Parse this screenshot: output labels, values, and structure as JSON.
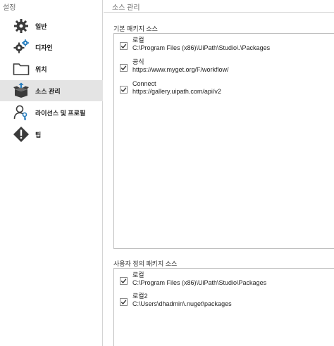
{
  "sidebar": {
    "title": "설정",
    "items": [
      {
        "label": "일반",
        "icon": "gear-icon"
      },
      {
        "label": "디자인",
        "icon": "gears-icon"
      },
      {
        "label": "위치",
        "icon": "folder-icon"
      },
      {
        "label": "소스 관리",
        "icon": "package-icon"
      },
      {
        "label": "라이선스 및 프로필",
        "icon": "user-key-icon"
      },
      {
        "label": "팁",
        "icon": "tip-icon"
      }
    ],
    "selected_index": 3,
    "selected_bg": "#e4e4e4"
  },
  "main": {
    "title": "소스 관리",
    "default_sources": {
      "label": "기본 패키지 소스",
      "items": [
        {
          "name": "로컬",
          "path": "C:\\Program Files (x86)\\UiPath\\Studio\\.\\Packages",
          "checked": true
        },
        {
          "name": "공식",
          "path": "https://www.myget.org/F/workflow/",
          "checked": true
        },
        {
          "name": "Connect",
          "path": "https://gallery.uipath.com/api/v2",
          "checked": true
        }
      ]
    },
    "custom_sources": {
      "label": "사용자 정의 패키지 소스",
      "items": [
        {
          "name": "로컬",
          "path": "C:\\Program Files (x86)\\UiPath\\Studio\\Packages",
          "checked": true
        },
        {
          "name": "로컬2",
          "path": "C:\\Users\\dhadmin\\.nuget\\packages",
          "checked": true
        }
      ]
    }
  }
}
